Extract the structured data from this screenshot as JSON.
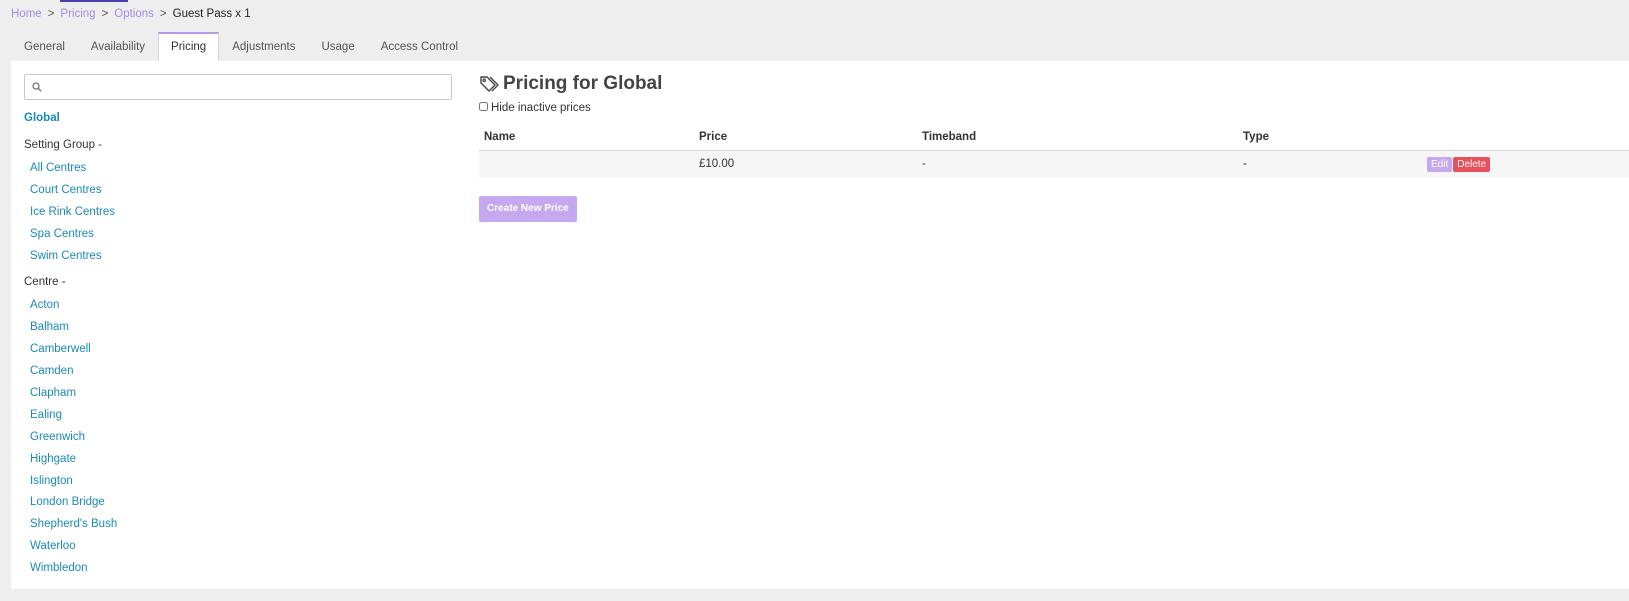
{
  "breadcrumb": {
    "items": [
      "Home",
      "Pricing",
      "Options"
    ],
    "current": "Guest Pass x 1",
    "separator": ">"
  },
  "tabs": [
    {
      "label": "General"
    },
    {
      "label": "Availability"
    },
    {
      "label": "Pricing",
      "active": true
    },
    {
      "label": "Adjustments"
    },
    {
      "label": "Usage"
    },
    {
      "label": "Access Control"
    }
  ],
  "sidebar": {
    "search": {
      "value": "",
      "placeholder": "",
      "icon": "search-icon"
    },
    "global_label": "Global",
    "setting_group": {
      "heading": "Setting Group -",
      "items": [
        "All Centres",
        "Court Centres",
        "Ice Rink Centres",
        "Spa Centres",
        "Swim Centres"
      ]
    },
    "centre": {
      "heading": "Centre -",
      "items": [
        "Acton",
        "Balham",
        "Camberwell",
        "Camden",
        "Clapham",
        "Ealing",
        "Greenwich",
        "Highgate",
        "Islington",
        "London Bridge",
        "Shepherd's Bush",
        "Waterloo",
        "Wimbledon"
      ]
    }
  },
  "main": {
    "title": "Pricing for Global",
    "title_icon": "tag-icon",
    "hide_inactive_label": "Hide inactive prices",
    "hide_inactive_checked": false,
    "table": {
      "headers": [
        "Name",
        "Price",
        "Timeband",
        "Type"
      ],
      "rows": [
        {
          "name": "",
          "price": "£10.00",
          "timeband": "-",
          "type": "-",
          "edit_label": "Edit",
          "delete_label": "Delete"
        }
      ]
    },
    "create_button": "Create New Price"
  },
  "colors": {
    "accent": "#c5a8f0",
    "link": "#1a8ab8",
    "breadcrumb_link": "#a78bea",
    "danger": "#e8505b"
  }
}
